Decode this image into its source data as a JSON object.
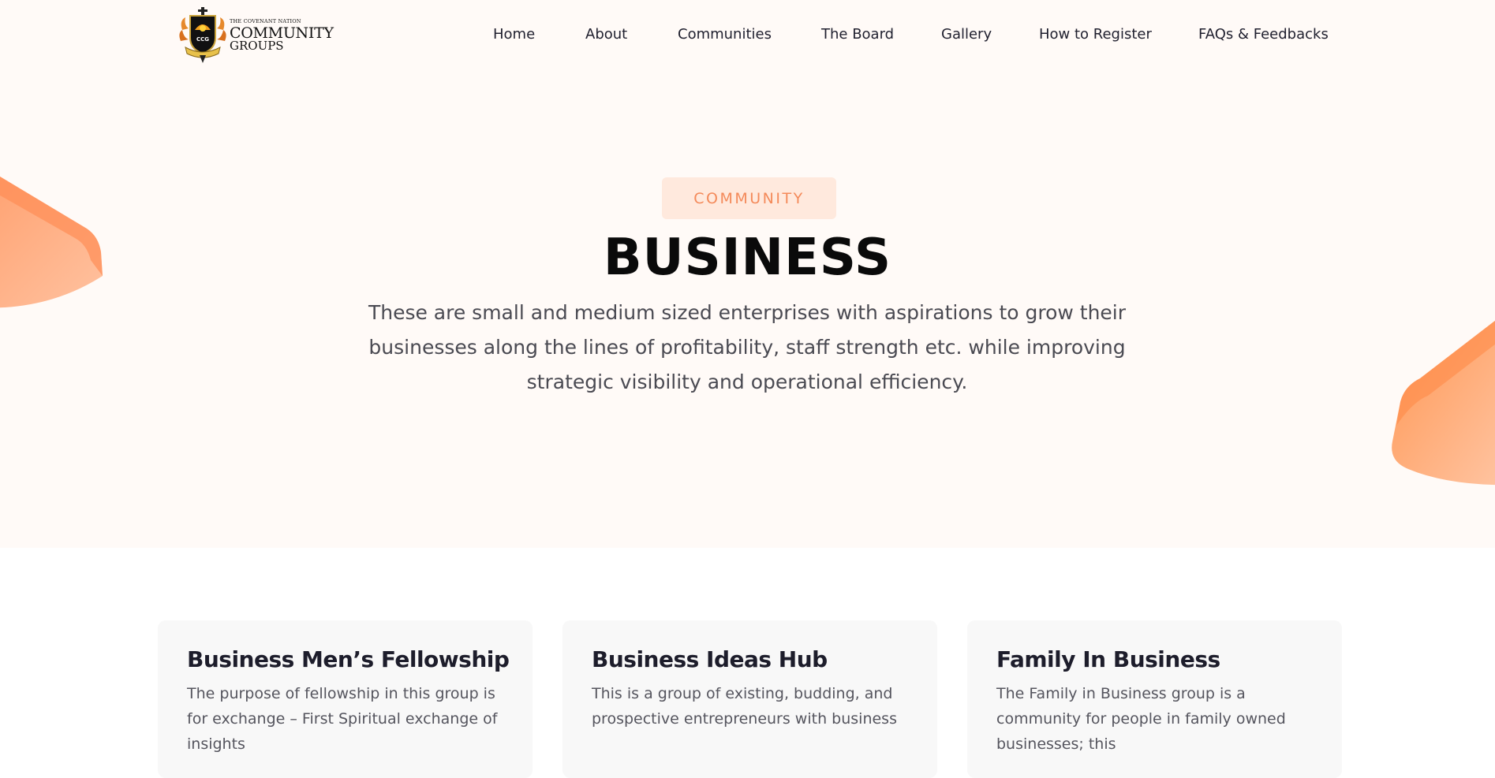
{
  "header": {
    "logo": {
      "small_text": "THE COVENANT NATION",
      "line1": "COMMUNITY",
      "line2": "GROUPS",
      "badge": "CCG"
    },
    "nav": [
      {
        "label": "Home"
      },
      {
        "label": "About"
      },
      {
        "label": "Communities"
      },
      {
        "label": "The Board"
      },
      {
        "label": "Gallery"
      },
      {
        "label": "How to Register"
      },
      {
        "label": "FAQs & Feedbacks"
      }
    ]
  },
  "hero": {
    "tag": "COMMUNITY",
    "title": "BUSINESS",
    "description": "These are small and medium sized enterprises with aspirations to grow their businesses along the lines of profitability, staff strength etc. while improving strategic visibility and operational efficiency."
  },
  "cards": [
    {
      "title": "Business Men’s Fellowship",
      "text": "The purpose of fellowship in this group is for exchange – First Spiritual exchange of insights"
    },
    {
      "title": "Business Ideas Hub",
      "text": "This is a group of existing, budding, and prospective entrepreneurs with business"
    },
    {
      "title": "Family In Business",
      "text": "The Family in Business group is a community for people in family owned businesses; this"
    }
  ],
  "colors": {
    "accent": "#f48a5a",
    "tag_bg": "#ffe9dd",
    "hero_bg": "#fffaf7",
    "card_bg": "#f8f8f8"
  }
}
